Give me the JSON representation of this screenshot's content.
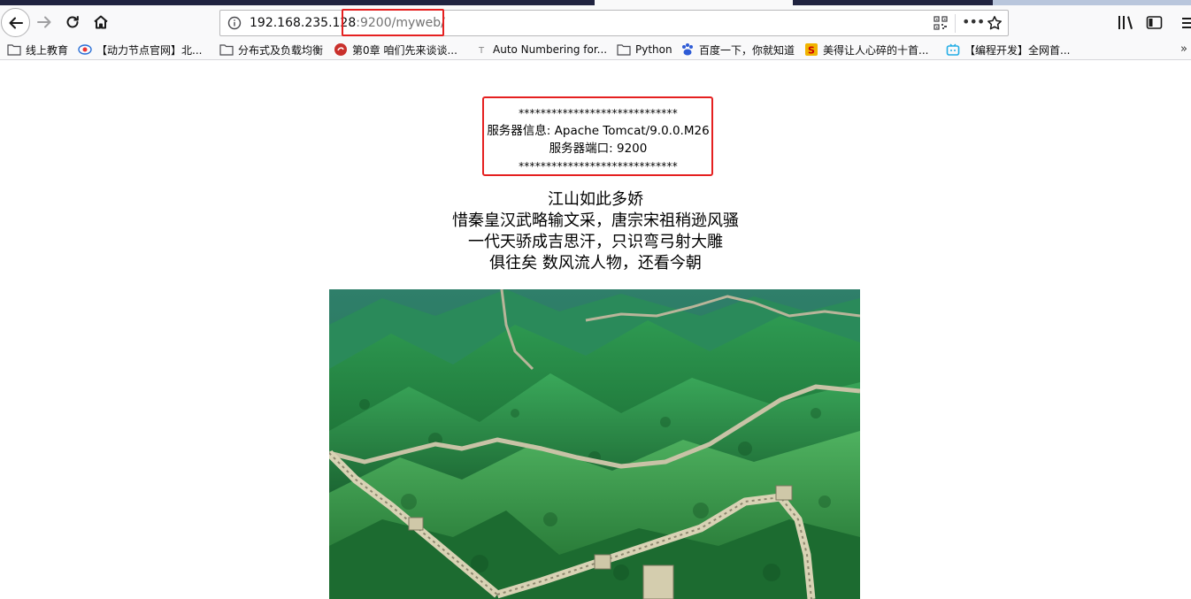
{
  "browser": {
    "url_host": "192.168.235.128",
    "url_path": ":9200/myweb/"
  },
  "bookmarks": [
    {
      "label": "线上教育",
      "icon": "folder-icon"
    },
    {
      "label": "【动力节点官网】北...",
      "icon": "site-icon"
    },
    {
      "label": "分布式及负载均衡",
      "icon": "folder-icon"
    },
    {
      "label": "第0章 咱们先来谈谈...",
      "icon": "site-icon"
    },
    {
      "label": "Auto Numbering for...",
      "icon": "site-icon"
    },
    {
      "label": "Python",
      "icon": "folder-icon"
    },
    {
      "label": "百度一下，你就知道",
      "icon": "baidu-icon"
    },
    {
      "label": "美得让人心碎的十首...",
      "icon": "site-icon"
    },
    {
      "label": "【编程开发】全网首...",
      "icon": "bilibili-icon"
    }
  ],
  "server_info": {
    "stars_top": "*****************************",
    "server_line": "服务器信息: Apache Tomcat/9.0.0.M26",
    "port_line": "服务器端口: 9200",
    "stars_bottom": "*****************************"
  },
  "poem": {
    "line1": "江山如此多娇",
    "line2": "惜秦皇汉武略输文采，唐宗宋祖稍逊风骚",
    "line3": "一代天骄成吉思汗，只识弯弓射大雕",
    "line4": "俱往矣 数风流人物，还看今朝"
  },
  "colors": {
    "highlight_red": "#e52020",
    "toolbar_bg": "#f9f9fa",
    "tabstrip_dark": "#202340"
  }
}
